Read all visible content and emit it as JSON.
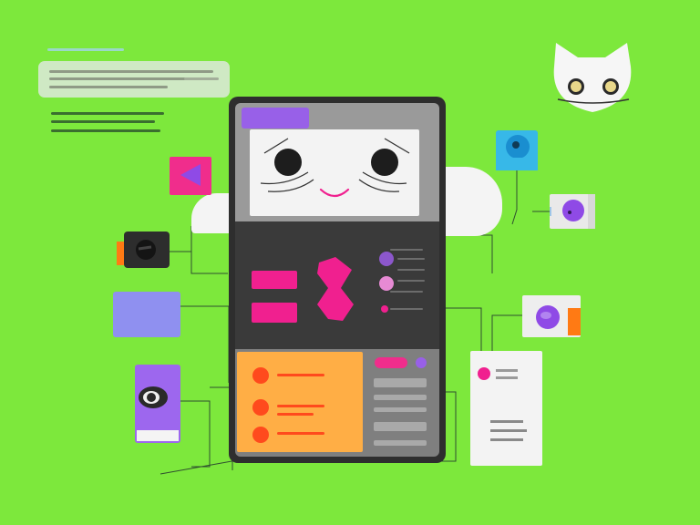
{
  "colors": {
    "background": "#7de83c",
    "phone_frame": "#2e2e2e",
    "accent_pink": "#f0208f",
    "accent_purple": "#9860e8",
    "accent_orange": "#ffae45",
    "accent_red": "#ff4a1d",
    "accent_cyan": "#37b8e8",
    "wire": "#2f4f2f"
  },
  "icons": {
    "cat": "cat-mascot-icon",
    "face": "smiling-face-icon",
    "play": "play-icon",
    "toggle": "toggle-knob-icon",
    "eye": "eye-icon",
    "radio": "radio-dot-icon"
  }
}
